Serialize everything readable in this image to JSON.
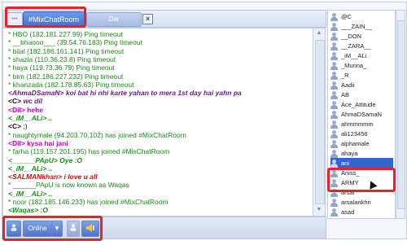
{
  "tabs": {
    "small_tab_label": "•••",
    "active_label": "#MixChatRoom",
    "second_label": "Dar",
    "close_symbol": "×"
  },
  "chat": [
    {
      "text": "* HBO (182.181.227.99) Ping timeout",
      "style": "sys"
    },
    {
      "text": "* __bhaooo___ (39.54.76.183) Ping timeout",
      "style": "sys"
    },
    {
      "text": "* bilal (182.186.161.141) Ping timeout",
      "style": "sys"
    },
    {
      "text": "* shazia (110.36.23.8) Ping timeout",
      "style": "sys"
    },
    {
      "text": "* haya (119.73.36.79) Ping timeout",
      "style": "sys"
    },
    {
      "text": "* btm (182.186.227.232) Ping timeout",
      "style": "sys"
    },
    {
      "text": "* khanzada (182.178.85.63) Ping timeout",
      "style": "sys"
    },
    {
      "name": "<AhmaDSamaN>",
      "name_style": "purple",
      "text": " koi bat hi nhi karte yahan to mera 1st day hai yahn pa",
      "style": "purple"
    },
    {
      "name": "<C>",
      "name_style": "black",
      "text": " wc dil",
      "style": "purple"
    },
    {
      "name": "<Dil>",
      "name_style": "mag",
      "text": " hehe",
      "style": "mag"
    },
    {
      "name": "<_iM__ALi>",
      "name_style": "green",
      "text": " ..",
      "style": "green"
    },
    {
      "name": "<C>",
      "name_style": "black",
      "text": " ;)",
      "style": "black"
    },
    {
      "text": "* naughtymale (94.203.70.102) has joined #MixChatRoom",
      "style": "sys"
    },
    {
      "name": "<Dil>",
      "name_style": "mag",
      "text": " kysa hai jani",
      "style": "mag"
    },
    {
      "text": "* farha (119.157.201.195) has joined #MixChatRoom",
      "style": "sys"
    },
    {
      "name": "<______PApU>",
      "name_style": "green",
      "text": " Oye :O",
      "style": "green"
    },
    {
      "name": "<_iM__ALi>",
      "name_style": "green",
      "text": " ..",
      "style": "green"
    },
    {
      "name": "<SALMANkhan>",
      "name_style": "red",
      "text": " i love u all",
      "style": "red"
    },
    {
      "text": "* ______PApU is now known as Waqas",
      "style": "sys"
    },
    {
      "name": "<_iM__ALi>",
      "name_style": "green",
      "text": " ..",
      "style": "green"
    },
    {
      "text": "* noor (182.185.146.233) has joined #MixChatRoom",
      "style": "sys"
    },
    {
      "name": "<Waqas>",
      "name_style": "green",
      "text": " :O",
      "style": "green"
    }
  ],
  "toolbar": {
    "status_label": "Online",
    "dropdown_symbol": "▼"
  },
  "users": [
    "@C",
    "___ZAIN__",
    "__DON",
    "__ZARA__",
    "_iM__ALi",
    "_Munna_",
    "_R",
    "Aadii",
    "AB",
    "Ace_Attitude",
    "AhmaDSamaN",
    "ahmmmmm",
    "ali123456",
    "alphamale",
    "ahaya",
    "ani",
    "Aniss_",
    "ARMY",
    "arsal",
    "arsalankhn",
    "asad"
  ],
  "selected_user_index": 15,
  "colors": {
    "highlight": "#e6222a",
    "tab_active": "#3f6fd2",
    "system_text": "#1d8a1d",
    "selection": "#2e66d7"
  }
}
